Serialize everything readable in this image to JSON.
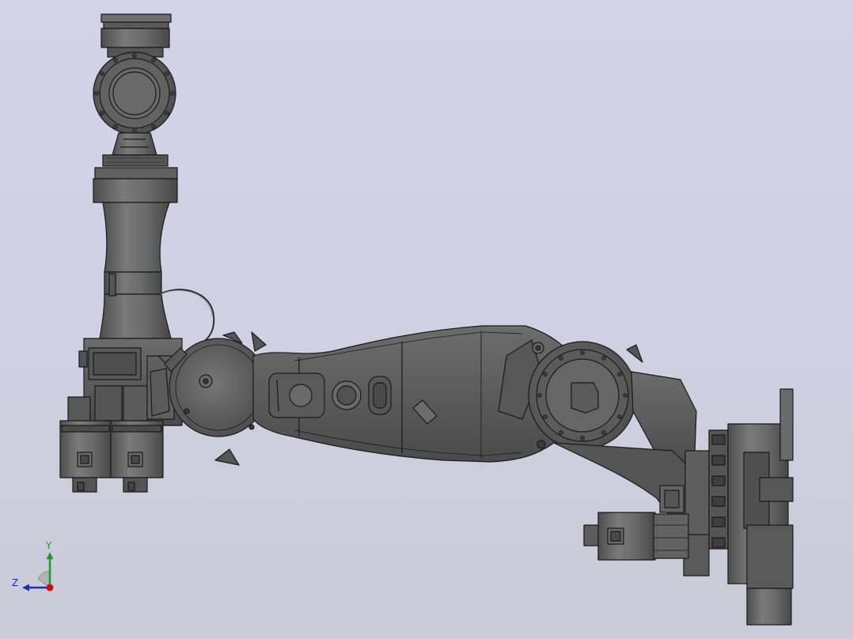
{
  "viewport": {
    "background_top": "#d3d3e8",
    "background_bottom": "#c9cbd6"
  },
  "model": {
    "body_color": "#5e5e5e",
    "edge_color": "#1a1a1a",
    "highlight_color": "#8a8a8a"
  },
  "triad": {
    "y_label": "Y",
    "z_label": "Z",
    "y_color": "#1e9a2c",
    "z_color": "#1d2fb5",
    "x_color": "#c41010"
  }
}
